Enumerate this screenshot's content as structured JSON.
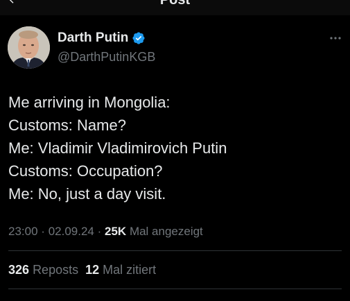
{
  "header": {
    "title": "Post"
  },
  "author": {
    "name": "Darth Putin",
    "handle": "@DarthPutinKGB",
    "verified": true
  },
  "tweet": {
    "lines": [
      "Me arriving in Mongolia:",
      "Customs: Name?",
      "Me: Vladimir Vladimirovich Putin",
      "Customs: Occupation?",
      "Me: No, just a day visit."
    ]
  },
  "meta": {
    "time": "23:00",
    "separator": "·",
    "date": "02.09.24",
    "views": "25K",
    "views_label": "Mal angezeigt"
  },
  "stats": {
    "reposts_count": "326",
    "reposts_label": "Reposts",
    "quotes_count": "12",
    "quotes_label": "Mal zitiert"
  },
  "colors": {
    "background": "#000000",
    "text_primary": "#e7e9ea",
    "text_secondary": "#71767b",
    "divider": "#2f3336",
    "verified_badge": "#1d9bf0"
  },
  "icons": {
    "back": "arrow-left-icon",
    "verified": "verified-badge-icon",
    "more": "more-horizontal-icon"
  }
}
